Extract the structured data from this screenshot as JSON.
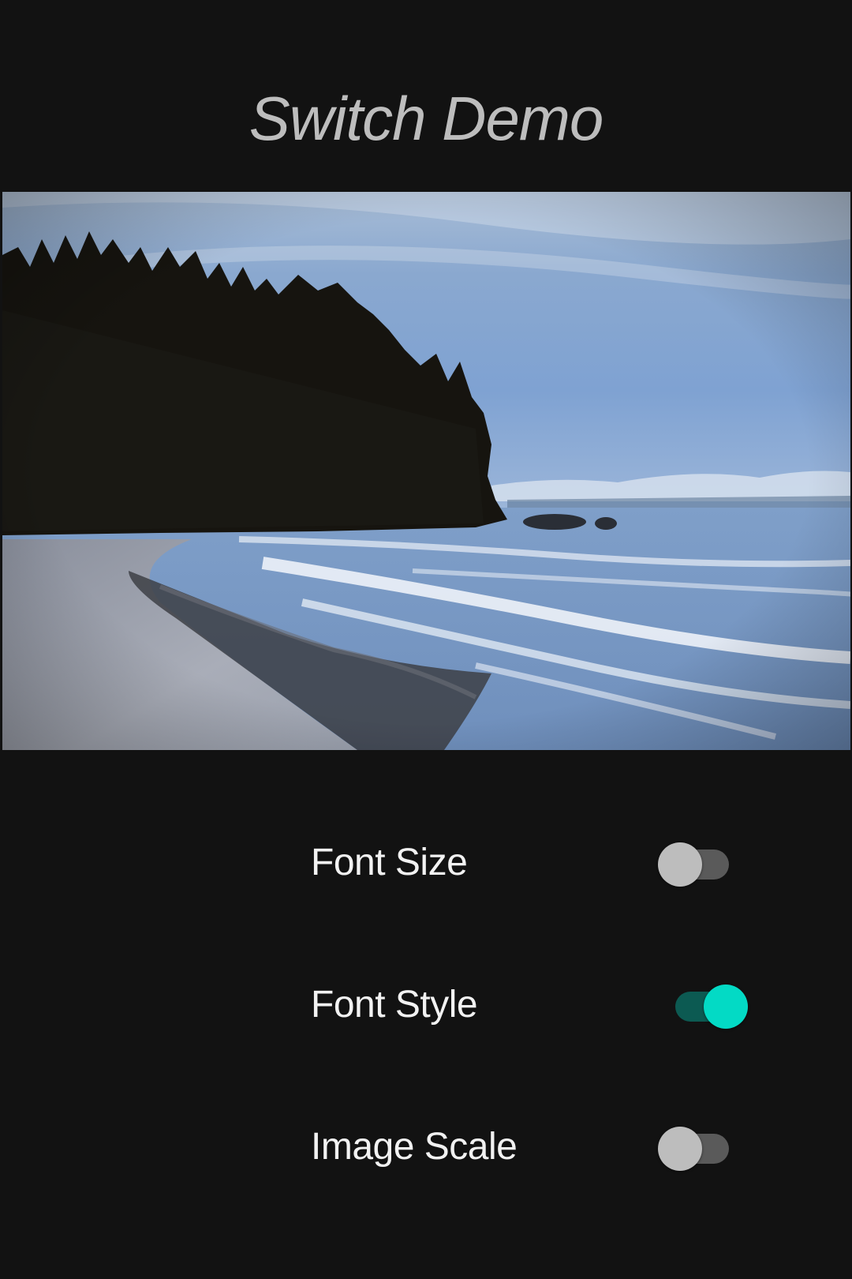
{
  "header": {
    "title": "Switch Demo"
  },
  "settings": [
    {
      "label": "Font Size",
      "enabled": false
    },
    {
      "label": "Font Style",
      "enabled": true
    },
    {
      "label": "Image Scale",
      "enabled": false
    }
  ],
  "colors": {
    "background": "#121212",
    "title": "#bdbdbd",
    "label": "#f2f2f2",
    "switch_on_thumb": "#03dac5",
    "switch_on_track": "#0c5a52",
    "switch_off_thumb": "#bdbdbd",
    "switch_off_track": "#5a5a5a"
  },
  "image": {
    "subject": "coastline-photo"
  }
}
